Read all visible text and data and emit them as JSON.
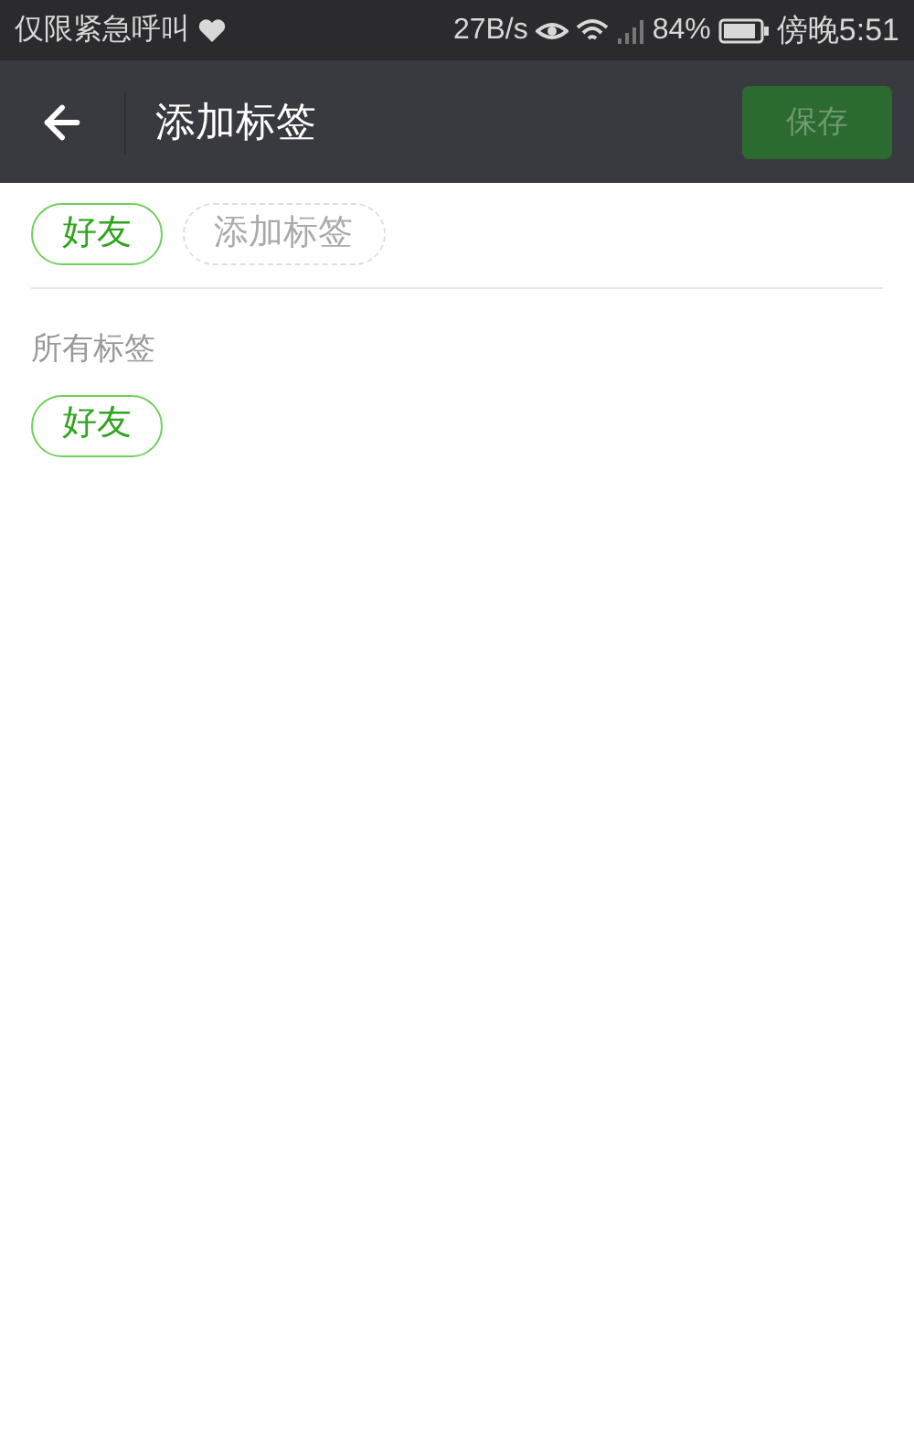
{
  "status_bar": {
    "carrier": "仅限紧急呼叫",
    "speed": "27B/s",
    "battery": "84%",
    "time": "傍晚5:51"
  },
  "header": {
    "title": "添加标签",
    "save_button": {
      "label": "保存",
      "disabled": true
    }
  },
  "tag_input": {
    "tags": [
      {
        "label": "好友",
        "selected": true
      }
    ],
    "placeholder": "添加标签"
  },
  "all_tags": {
    "heading": "所有标签",
    "tags": [
      {
        "label": "好友",
        "selected": true
      }
    ]
  }
}
